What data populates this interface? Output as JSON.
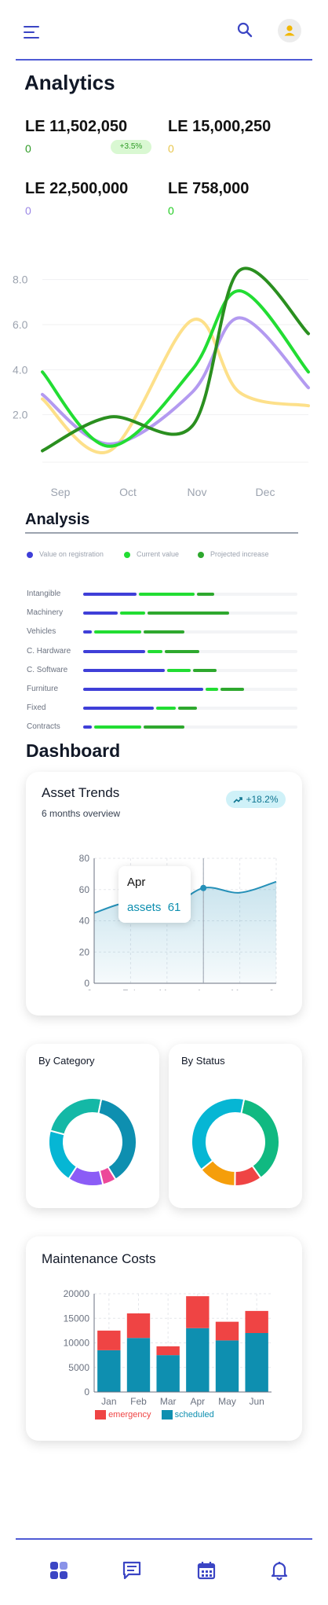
{
  "header": {
    "menu_icon": "hamburger-menu-icon",
    "search_icon": "search-icon",
    "avatar_icon": "user-avatar-icon",
    "accent": "#3b45c4"
  },
  "analytics": {
    "title": "Analytics",
    "stats": [
      {
        "value": "LE 11,502,050",
        "sub": "0",
        "sub_color": "#2e9b25"
      },
      {
        "value": "LE 15,000,250",
        "sub": "0",
        "sub_color": "#e8c64d"
      },
      {
        "value": "LE 22,500,000",
        "sub": "0",
        "sub_color": "#9b87e6"
      },
      {
        "value": "LE 758,000",
        "sub": "0",
        "sub_color": "#22cc22"
      }
    ],
    "badge": "+3.5%"
  },
  "line_chart": {
    "y_ticks": [
      "8.0",
      "6.0",
      "4.0",
      "2.0"
    ],
    "x_ticks": [
      "Sep",
      "Oct",
      "Nov",
      "Dec"
    ]
  },
  "analysis": {
    "title": "Analysis",
    "legend": [
      {
        "label": "Value on registration",
        "color": "#3f3fd8"
      },
      {
        "label": "Current value",
        "color": "#22dd33"
      },
      {
        "label": "Projected increase",
        "color": "#2ea82e"
      }
    ],
    "rows": [
      {
        "label": "Intangible",
        "registration": 0.25,
        "current": 0.26,
        "projected": 0.08
      },
      {
        "label": "Machinery",
        "registration": 0.16,
        "current": 0.12,
        "projected": 0.38
      },
      {
        "label": "Vehicles",
        "registration": 0.04,
        "current": 0.22,
        "projected": 0.19
      },
      {
        "label": "C. Hardware",
        "registration": 0.29,
        "current": 0.07,
        "projected": 0.16
      },
      {
        "label": "C. Software",
        "registration": 0.38,
        "current": 0.11,
        "projected": 0.11
      },
      {
        "label": "Furniture",
        "registration": 0.56,
        "current": 0.06,
        "projected": 0.11
      },
      {
        "label": "Fixed",
        "registration": 0.33,
        "current": 0.09,
        "projected": 0.09
      },
      {
        "label": "Contracts",
        "registration": 0.04,
        "current": 0.22,
        "projected": 0.19
      }
    ]
  },
  "dashboard": {
    "title": "Dashboard",
    "asset_trends": {
      "title": "Asset Trends",
      "subtitle": "6 months overview",
      "badge": "+18.2%",
      "tooltip_month": "Apr",
      "tooltip_label": "assets",
      "tooltip_value": "61"
    },
    "by_category": {
      "title": "By Category"
    },
    "by_status": {
      "title": "By Status"
    },
    "maintenance": {
      "title": "Maintenance Costs",
      "legend_emergency": "emergency",
      "legend_scheduled": "scheduled"
    }
  },
  "bottom_nav": {
    "icons": [
      "dashboard-icon",
      "messages-icon",
      "calendar-icon",
      "notifications-icon"
    ],
    "accent": "#3b45c4"
  },
  "chart_data": [
    {
      "type": "line",
      "x": [
        "Sep",
        "Oct",
        "Nov",
        "Dec"
      ],
      "ylim": [
        0,
        9.0
      ],
      "y_ticks": [
        2.0,
        4.0,
        6.0,
        8.0
      ],
      "series": [
        {
          "color": "#fde08a",
          "values": [
            2.7,
            0.4,
            6.2,
            3.0,
            2.4
          ]
        },
        {
          "color": "#b39af0",
          "values": [
            2.9,
            0.7,
            3.0,
            6.3,
            3.2
          ]
        },
        {
          "color": "#22dd33",
          "values": [
            3.9,
            0.6,
            4.0,
            7.5,
            3.9
          ]
        },
        {
          "color": "#2a8f1f",
          "values": [
            0.4,
            1.9,
            1.5,
            8.4,
            5.6
          ]
        }
      ]
    },
    {
      "type": "area",
      "title": "Asset Trends",
      "categories": [
        "Jan",
        "Feb",
        "Mar",
        "Apr",
        "May",
        "Jun"
      ],
      "values": [
        45,
        52,
        48,
        61,
        58,
        65
      ],
      "ylim": [
        0,
        80
      ],
      "y_ticks": [
        0,
        20,
        40,
        60,
        80
      ],
      "color": "#2590b8"
    },
    {
      "type": "pie",
      "title": "By Category",
      "slices": [
        {
          "value": 38,
          "color": "#0e8fb0"
        },
        {
          "value": 5,
          "color": "#ec4899"
        },
        {
          "value": 13,
          "color": "#8b5cf6"
        },
        {
          "value": 20,
          "color": "#06b6d4"
        },
        {
          "value": 24,
          "color": "#14b8a6"
        }
      ]
    },
    {
      "type": "pie",
      "title": "By Status",
      "slices": [
        {
          "value": 37,
          "color": "#10b981"
        },
        {
          "value": 10,
          "color": "#ef4444"
        },
        {
          "value": 14,
          "color": "#f59e0b"
        },
        {
          "value": 39,
          "color": "#06b6d4"
        }
      ]
    },
    {
      "type": "bar",
      "title": "Maintenance Costs",
      "categories": [
        "Jan",
        "Feb",
        "Mar",
        "Apr",
        "May",
        "Jun"
      ],
      "ylim": [
        0,
        20000
      ],
      "y_ticks": [
        0,
        5000,
        10000,
        15000,
        20000
      ],
      "series": [
        {
          "name": "scheduled",
          "color": "#0e8fb0",
          "values": [
            8500,
            11000,
            7500,
            13000,
            10500,
            12000
          ]
        },
        {
          "name": "emergency",
          "color": "#ef4444",
          "values": [
            4000,
            5000,
            1800,
            6500,
            3800,
            4500
          ]
        }
      ]
    }
  ]
}
